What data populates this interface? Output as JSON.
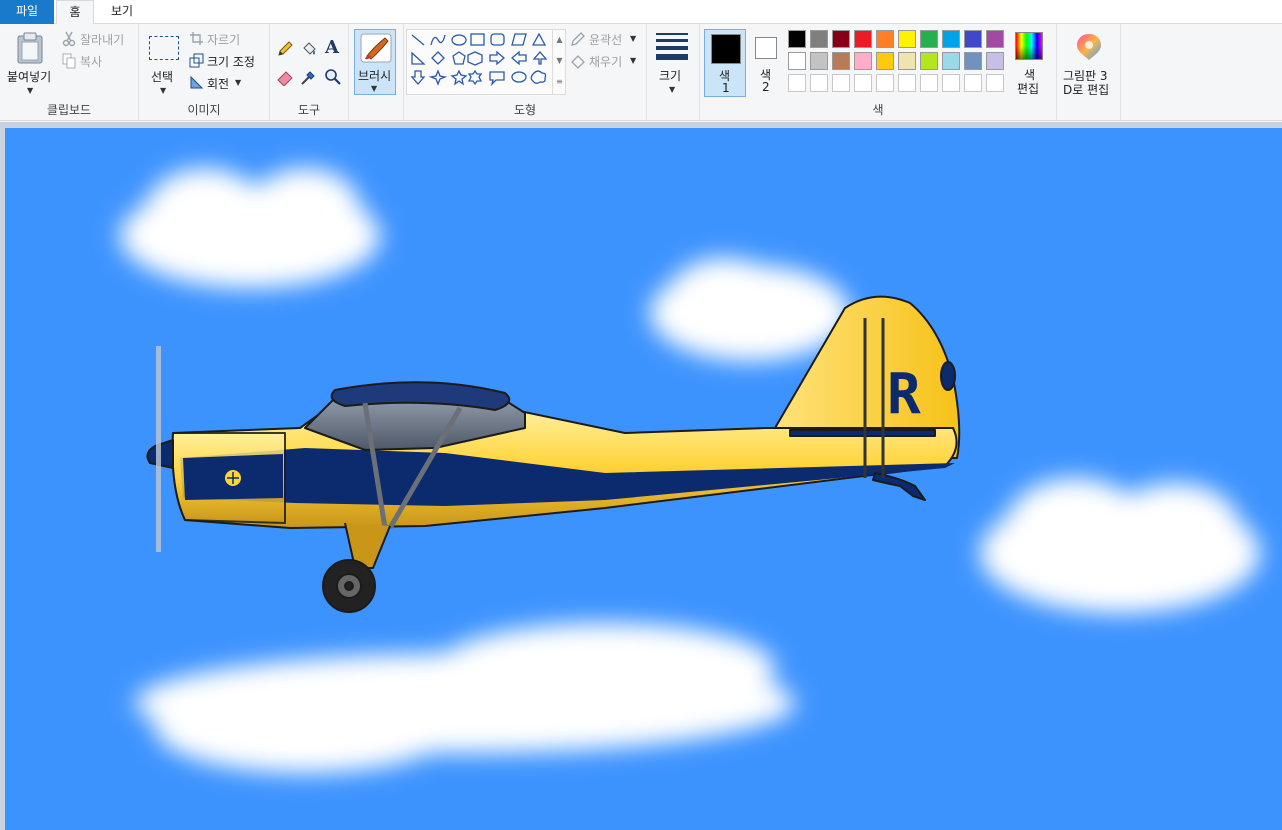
{
  "tabs": {
    "file": "파일",
    "home": "홈",
    "view": "보기"
  },
  "clipboard": {
    "paste": "붙여넣기",
    "cut": "잘라내기",
    "copy": "복사",
    "label": "클립보드"
  },
  "image": {
    "select": "선택",
    "crop": "자르기",
    "resize": "크기 조정",
    "rotate": "회전",
    "label": "이미지"
  },
  "tools": {
    "label": "도구",
    "text_glyph": "A"
  },
  "brush": {
    "label": "브러시"
  },
  "shapes": {
    "outline": "윤곽선",
    "fill": "채우기",
    "label": "도형"
  },
  "size": {
    "label": "크기"
  },
  "colors": {
    "color1": "색",
    "color1_num": "1",
    "color2": "색",
    "color2_num": "2",
    "edit_line1": "색",
    "edit_line2": "편집",
    "label": "색",
    "palette_row1": [
      "#000000",
      "#7f7f7f",
      "#880015",
      "#ed1c24",
      "#ff7f27",
      "#fff200",
      "#22b14c",
      "#00a2e8",
      "#3f48cc",
      "#a349a4"
    ],
    "palette_row2": [
      "#ffffff",
      "#c3c3c3",
      "#b97a57",
      "#ffaec9",
      "#ffc90e",
      "#efe4b0",
      "#b5e61d",
      "#99d9ea",
      "#7092be",
      "#c8bfe7"
    ],
    "active_color1": "#000000",
    "active_color2": "#ffffff"
  },
  "paint3d": {
    "line1": "그림판 3",
    "line2": "D로 편집"
  },
  "canvas": {
    "sky_color": "#3d93fe",
    "tail_letter": "R"
  }
}
